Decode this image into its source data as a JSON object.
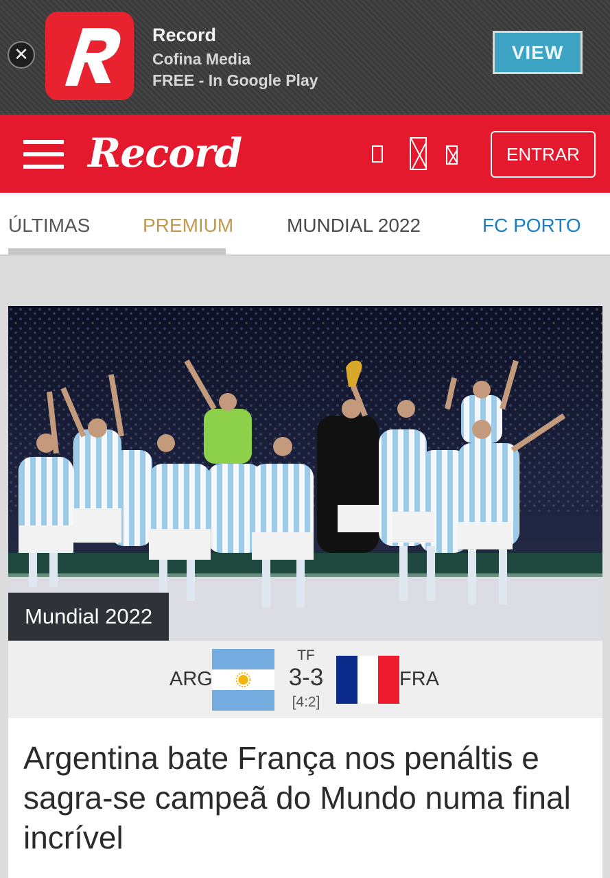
{
  "ad": {
    "app_name": "Record",
    "publisher": "Cofina Media",
    "store_line": "FREE - In Google Play",
    "view_label": "VIEW",
    "close_symbol": "✕"
  },
  "header": {
    "brand": "Record",
    "login_label": "ENTRAR",
    "icons": [
      "social-icon",
      "social-icon",
      "social-icon"
    ],
    "color": "#e4192e"
  },
  "tabs": [
    {
      "label": "ÚLTIMAS"
    },
    {
      "label": "PREMIUM"
    },
    {
      "label": "MUNDIAL 2022"
    },
    {
      "label": "FC PORTO"
    }
  ],
  "article": {
    "category": "Mundial 2022",
    "headline": "Argentina bate França nos penáltis e sagra-se campeã do Mundo numa final incrível",
    "match": {
      "home": "ARG",
      "away": "FRA",
      "status": "TF",
      "score": "3-3",
      "penalties": "[4:2]"
    }
  }
}
